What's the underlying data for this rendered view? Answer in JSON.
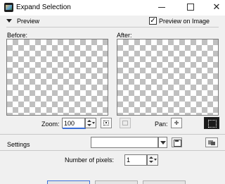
{
  "window": {
    "title": "Expand Selection",
    "minimize_label": "minimize",
    "maximize_label": "maximize",
    "close_label": "close"
  },
  "preview": {
    "section_label": "Preview",
    "preview_on_image_label": "Preview on Image",
    "preview_on_image_checked": true,
    "before_label": "Before:",
    "after_label": "After:"
  },
  "zoom": {
    "label": "Zoom:",
    "value": "100",
    "pan_label": "Pan:"
  },
  "settings": {
    "label": "Settings",
    "selected_preset": ""
  },
  "options": {
    "pixels_label": "Number of pixels:",
    "pixels_value": "1"
  },
  "colors": {
    "dialog_bg": "#f0f0f0",
    "accent": "#3c6fd8",
    "checker_dark": "#c0c0c0",
    "checker_light": "#ffffff"
  }
}
